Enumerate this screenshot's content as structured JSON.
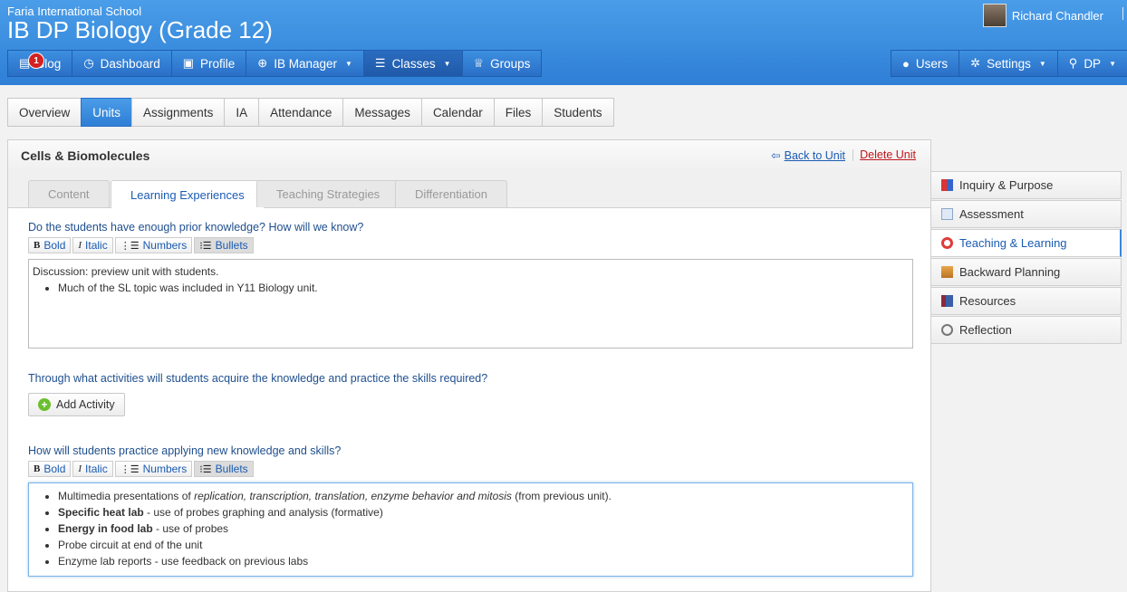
{
  "header": {
    "school": "Faria International School",
    "class_title": "IB DP Biology (Grade 12)",
    "user_name": "Richard Chandler",
    "nav": [
      {
        "label": "Blog",
        "badge": "1",
        "icon": "blog-icon"
      },
      {
        "label": "Dashboard",
        "icon": "dashboard-icon"
      },
      {
        "label": "Profile",
        "icon": "profile-icon"
      },
      {
        "label": "IB Manager",
        "icon": "globe-icon",
        "dropdown": true
      },
      {
        "label": "Classes",
        "icon": "classes-icon",
        "dropdown": true,
        "active": true
      },
      {
        "label": "Groups",
        "icon": "trophy-icon"
      }
    ],
    "nav_right": [
      {
        "label": "Users",
        "icon": "user-icon"
      },
      {
        "label": "Settings",
        "icon": "gear-icon",
        "dropdown": true
      },
      {
        "label": "DP",
        "icon": "search-icon",
        "dropdown": true
      }
    ]
  },
  "subnav": [
    "Overview",
    "Units",
    "Assignments",
    "IA",
    "Attendance",
    "Messages",
    "Calendar",
    "Files",
    "Students"
  ],
  "subnav_active": "Units",
  "unit": {
    "title": "Cells & Biomolecules",
    "back_label": "Back to Unit",
    "delete_label": "Delete Unit",
    "tabs": [
      "Content",
      "Learning Experiences",
      "Teaching Strategies",
      "Differentiation"
    ],
    "active_tab": "Learning Experiences"
  },
  "toolbar": {
    "bold": "Bold",
    "italic": "Italic",
    "numbers": "Numbers",
    "bullets": "Bullets"
  },
  "q1": {
    "question": "Do the students have enough prior knowledge? How will we know?",
    "text": "Discussion: preview unit with students.",
    "bullets": [
      "Much of the SL topic was included in Y11 Biology unit."
    ]
  },
  "q2": {
    "question": "Through what activities will students acquire the knowledge and practice the skills required?",
    "add_label": "Add Activity"
  },
  "q3": {
    "question": "How will students practice applying new knowledge and skills?",
    "b1_pre": "Multimedia presentations of ",
    "b1_em": "replication, transcription, translation, enzyme behavior and mitosis",
    "b1_post": " (from previous unit).",
    "b2_strong": "Specific heat lab",
    "b2_rest": " - use of probes graphing and analysis (formative)",
    "b3_strong": "Energy in food lab",
    "b3_rest": " - use of probes",
    "b4": "Probe circuit at end of the unit",
    "b5": "Enzyme lab reports - use feedback on previous labs"
  },
  "side_nav": [
    {
      "label": "Inquiry & Purpose",
      "icon": "blocks-icon"
    },
    {
      "label": "Assessment",
      "icon": "document-icon"
    },
    {
      "label": "Teaching & Learning",
      "icon": "target-icon",
      "active": true
    },
    {
      "label": "Backward Planning",
      "icon": "signpost-icon"
    },
    {
      "label": "Resources",
      "icon": "book-icon"
    },
    {
      "label": "Reflection",
      "icon": "magnifier-icon"
    }
  ],
  "colors": {
    "brand": "#2e7fd6",
    "link": "#1a5bb3",
    "danger": "#c0151b"
  }
}
